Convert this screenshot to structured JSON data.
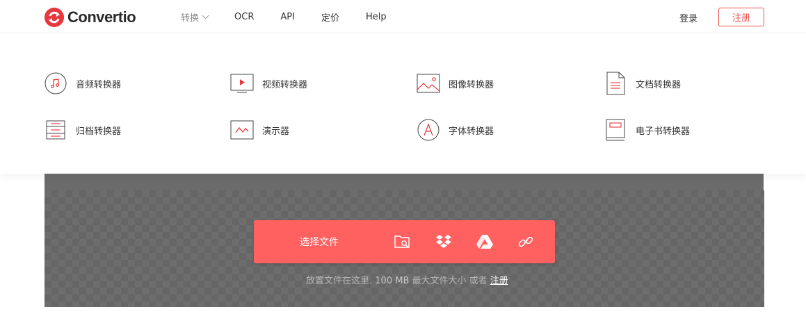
{
  "header": {
    "logo_text": "Convertio",
    "nav": [
      {
        "label": "转换",
        "has_dropdown": true
      },
      {
        "label": "OCR"
      },
      {
        "label": "API"
      },
      {
        "label": "定价"
      },
      {
        "label": "Help"
      }
    ],
    "login_label": "登录",
    "register_label": "注册"
  },
  "dropdown": {
    "items": [
      {
        "label": "音频转换器",
        "icon": "music-note-icon"
      },
      {
        "label": "视频转换器",
        "icon": "video-play-icon"
      },
      {
        "label": "图像转换器",
        "icon": "image-icon"
      },
      {
        "label": "文档转换器",
        "icon": "document-icon"
      },
      {
        "label": "归档转换器",
        "icon": "archive-icon"
      },
      {
        "label": "演示器",
        "icon": "presentation-icon"
      },
      {
        "label": "字体转换器",
        "icon": "font-icon"
      },
      {
        "label": "电子书转换器",
        "icon": "ebook-icon"
      }
    ]
  },
  "upload": {
    "choose_label": "选择文件",
    "icons": [
      "folder-search-icon",
      "dropbox-icon",
      "google-drive-icon",
      "link-icon"
    ],
    "hint_prefix": "放置文件在这里.",
    "hint_size": "100 MB",
    "hint_mid": "最大文件大小 或者",
    "hint_link": "注册"
  },
  "colors": {
    "brand_red": "#e8383d",
    "accent": "#ff6060",
    "dark_bg": "#6d6d6d"
  }
}
